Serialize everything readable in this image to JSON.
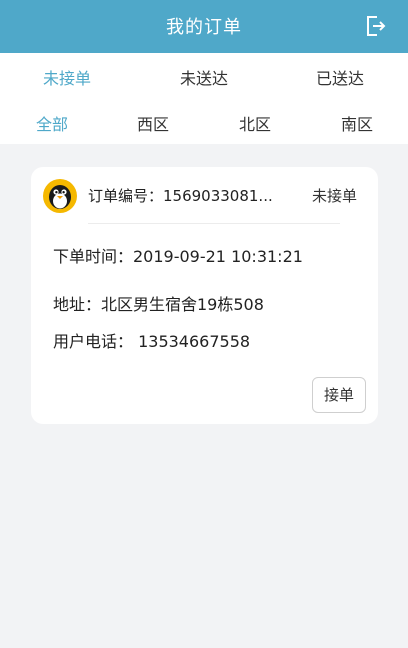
{
  "theme": {
    "accent": "#4fa8c9"
  },
  "header": {
    "title": "我的订单",
    "logout_icon": "logout-icon"
  },
  "status_tabs": [
    {
      "label": "未接单",
      "active": true
    },
    {
      "label": "未送达",
      "active": false
    },
    {
      "label": "已送达",
      "active": false
    }
  ],
  "area_tabs": [
    {
      "label": "全部",
      "active": true
    },
    {
      "label": "西区",
      "active": false
    },
    {
      "label": "北区",
      "active": false
    },
    {
      "label": "南区",
      "active": false
    }
  ],
  "order": {
    "avatar_icon": "penguin-avatar-icon",
    "order_no": "订单编号：1569033081...",
    "status": "未接单",
    "time": "下单时间：2019-09-21 10:31:21",
    "address": "地址：北区男生宿舍19栋508",
    "phone": "用户电话： 13534667558",
    "accept_label": "接单"
  }
}
